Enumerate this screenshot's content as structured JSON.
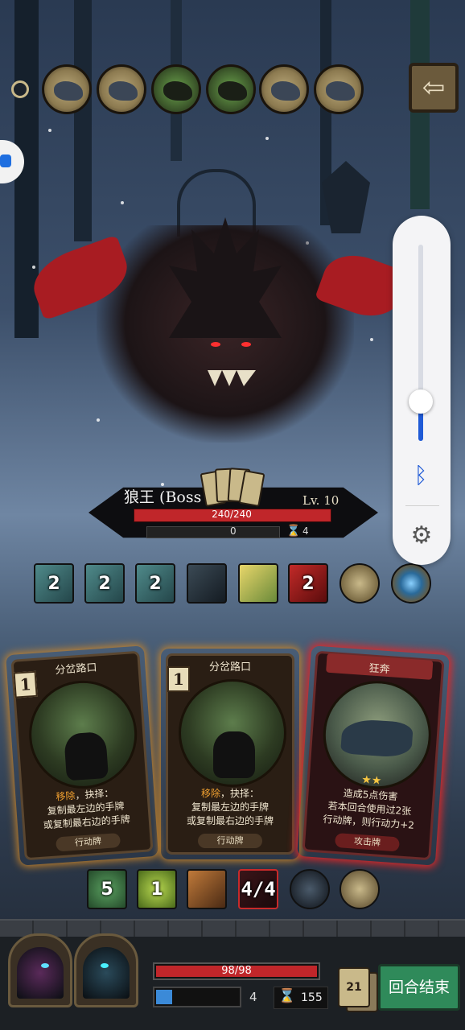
{
  "enemy_queue": [
    "wolf-icon",
    "wolf-icon",
    "werewolf-icon",
    "werewolf-icon",
    "wolf-icon",
    "wolf-icon"
  ],
  "back_icon": "arrow-left-icon",
  "boss": {
    "name": "狼王 (Boss",
    "level": "Lv. 10",
    "hp_text": "240/240",
    "hp_fraction": 1.0,
    "shield_value": "0",
    "hourglass_value": "4"
  },
  "boss_intents": [
    {
      "value": "2",
      "icon": "claw-icon",
      "style": "teal"
    },
    {
      "value": "2",
      "icon": "claw-icon",
      "style": "teal"
    },
    {
      "value": "2",
      "icon": "claw-icon",
      "style": "teal"
    },
    {
      "value": "",
      "icon": "hooded-figure-icon",
      "style": "dark"
    },
    {
      "value": "",
      "icon": "book-icon",
      "style": "gold"
    },
    {
      "value": "2",
      "icon": "blood-icon",
      "style": "red"
    },
    {
      "value": "",
      "icon": "plant-pot-icon",
      "style": "round"
    },
    {
      "value": "",
      "icon": "crystal-icon",
      "style": "round"
    }
  ],
  "volume_panel": {
    "level": 0.2,
    "bluetooth_icon": "bluetooth-icon",
    "settings_icon": "gear-icon"
  },
  "hand": [
    {
      "cost": "1",
      "title": "分岔路口",
      "desc_hl": "移除",
      "desc_rest": "，抉择：",
      "desc_line2": "复制最左边的手牌",
      "desc_line3": "或复制最右边的手牌",
      "type": "行动牌"
    },
    {
      "cost": "1",
      "title": "分岔路口",
      "desc_hl": "移除",
      "desc_rest": "，抉择：",
      "desc_line2": "复制最左边的手牌",
      "desc_line3": "或复制最右边的手牌",
      "type": "行动牌"
    },
    {
      "cost": "",
      "title": "狂奔",
      "stars": "★★",
      "desc_line1": "造成5点伤害",
      "desc_line2": "若本回合使用过2张",
      "desc_line3": "行动牌，则行动力+2",
      "type": "攻击牌"
    }
  ],
  "status": [
    {
      "value": "5",
      "icon": "green-orb-icon"
    },
    {
      "value": "1",
      "icon": "lime-orb-icon"
    },
    {
      "value": "",
      "icon": "beast-icon"
    },
    {
      "value": "4/4",
      "icon": "counter-icon"
    },
    {
      "value": "",
      "icon": "wolf-head-icon"
    },
    {
      "value": "",
      "icon": "shadow-icon"
    }
  ],
  "player": {
    "hp_text": "98/98",
    "hp_fraction": 1.0,
    "energy_fraction": 0.2,
    "energy_value": "4",
    "time_value": "155",
    "deck_count": "21",
    "end_turn_label": "回合结束"
  }
}
